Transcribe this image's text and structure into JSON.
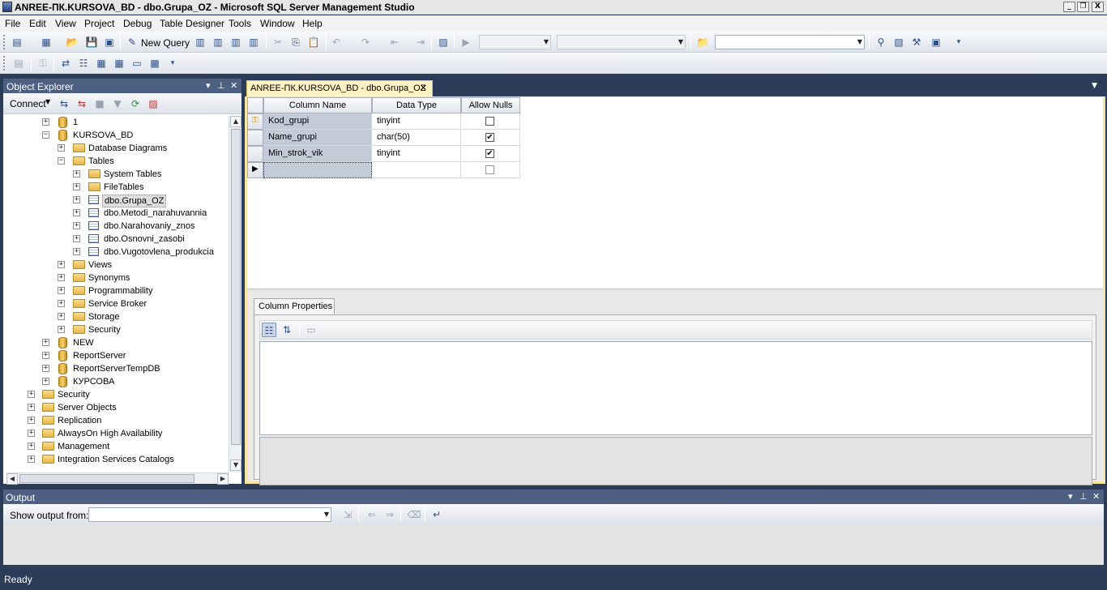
{
  "window": {
    "title": "ANREE-ПК.KURSOVA_BD - dbo.Grupa_OZ - Microsoft SQL Server Management Studio",
    "controls": [
      "_",
      "❐",
      "X"
    ]
  },
  "menu": [
    "File",
    "Edit",
    "View",
    "Project",
    "Debug",
    "Table Designer",
    "Tools",
    "Window",
    "Help"
  ],
  "toolbar": {
    "new_query_label": "New Query",
    "search_combo_value": ""
  },
  "object_explorer": {
    "title": "Object Explorer",
    "connect_label": "Connect",
    "controls": [
      "▾",
      "⊥",
      "✕"
    ],
    "nodes": [
      {
        "label": "1",
        "icon": "database-icon",
        "expander": "+"
      },
      {
        "label": "KURSOVA_BD",
        "icon": "database-icon",
        "expander": "−"
      },
      {
        "label": "Database Diagrams",
        "icon": "folder-icon",
        "expander": "+"
      },
      {
        "label": "Tables",
        "icon": "folder-icon",
        "expander": "−"
      },
      {
        "label": "System Tables",
        "icon": "folder-icon",
        "expander": "+"
      },
      {
        "label": "FileTables",
        "icon": "folder-icon",
        "expander": "+"
      },
      {
        "label": "dbo.Grupa_OZ",
        "icon": "table-icon",
        "expander": "+",
        "selected": true
      },
      {
        "label": "dbo.Metodi_narahuvannia",
        "icon": "table-icon",
        "expander": "+"
      },
      {
        "label": "dbo.Narahovaniy_znos",
        "icon": "table-icon",
        "expander": "+"
      },
      {
        "label": "dbo.Osnovni_zasobi",
        "icon": "table-icon",
        "expander": "+"
      },
      {
        "label": "dbo.Vugotovlena_produkcia",
        "icon": "table-icon",
        "expander": "+"
      },
      {
        "label": "Views",
        "icon": "folder-icon",
        "expander": "+"
      },
      {
        "label": "Synonyms",
        "icon": "folder-icon",
        "expander": "+"
      },
      {
        "label": "Programmability",
        "icon": "folder-icon",
        "expander": "+"
      },
      {
        "label": "Service Broker",
        "icon": "folder-icon",
        "expander": "+"
      },
      {
        "label": "Storage",
        "icon": "folder-icon",
        "expander": "+"
      },
      {
        "label": "Security",
        "icon": "folder-icon",
        "expander": "+"
      },
      {
        "label": "NEW",
        "icon": "database-icon",
        "expander": "+"
      },
      {
        "label": "ReportServer",
        "icon": "database-icon",
        "expander": "+"
      },
      {
        "label": "ReportServerTempDB",
        "icon": "database-icon",
        "expander": "+"
      },
      {
        "label": "КУРСОВА",
        "icon": "database-icon",
        "expander": "+"
      },
      {
        "label": "Security",
        "icon": "folder-icon",
        "expander": "+"
      },
      {
        "label": "Server Objects",
        "icon": "folder-icon",
        "expander": "+"
      },
      {
        "label": "Replication",
        "icon": "folder-icon",
        "expander": "+"
      },
      {
        "label": "AlwaysOn High Availability",
        "icon": "folder-icon",
        "expander": "+"
      },
      {
        "label": "Management",
        "icon": "folder-icon",
        "expander": "+"
      },
      {
        "label": "Integration Services Catalogs",
        "icon": "folder-icon",
        "expander": "+"
      }
    ]
  },
  "document": {
    "tab_title": "ANREE-ПК.KURSOVA_BD - dbo.Grupa_OZ",
    "tab_close": "✕",
    "columns_header": [
      "Column Name",
      "Data Type",
      "Allow Nulls"
    ],
    "rows": [
      {
        "name": "Kod_grupi",
        "type": "tinyint",
        "nulls": false,
        "key": true
      },
      {
        "name": "Name_grupi",
        "type": "char(50)",
        "nulls": true,
        "key": false
      },
      {
        "name": "Min_strok_vik",
        "type": "tinyint",
        "nulls": true,
        "key": false
      },
      {
        "name": "",
        "type": "",
        "nulls": false,
        "key": false,
        "new_row": true
      }
    ],
    "column_properties_tab": "Column Properties"
  },
  "output": {
    "title": "Output",
    "show_from_label": "Show output from:",
    "show_from_value": ""
  },
  "status": {
    "text": "Ready"
  }
}
